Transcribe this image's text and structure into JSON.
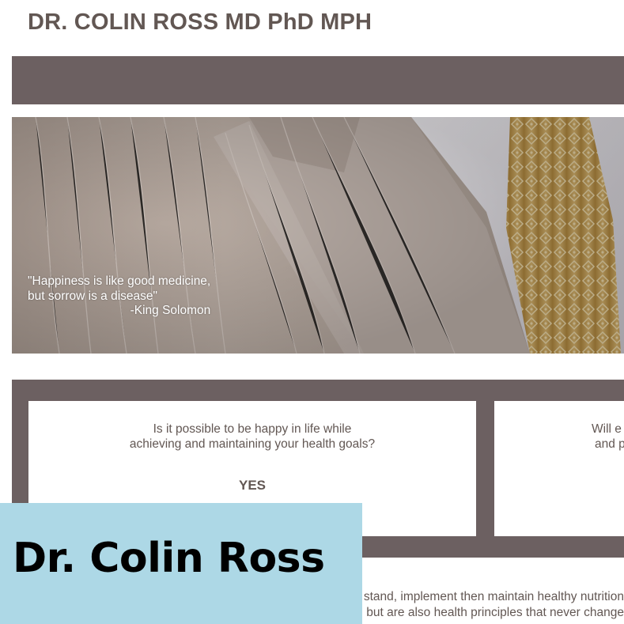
{
  "header": {
    "site_title": "DR. COLIN ROSS MD PhD MPH"
  },
  "hero": {
    "quote_line1": "\"Happiness is like good medicine,",
    "quote_line2": "but sorrow is a disease\"",
    "attribution": "-King Solomon"
  },
  "qa_cards": [
    {
      "question_line1": "Is it possible to be happy in life while",
      "question_line2": "achieving and maintaining your health goals?",
      "answer": "YES"
    },
    {
      "question_line1": "Will e",
      "question_line2": "and p"
    }
  ],
  "body": {
    "line1": "stand, implement then maintain healthy nutrition",
    "line2": "but are also health principles that never change"
  },
  "overlay": {
    "name": "Dr. Colin Ross"
  },
  "colors": {
    "brand_taupe": "#6c6061",
    "text_brown": "#625753",
    "overlay_blue": "#add8e6"
  }
}
